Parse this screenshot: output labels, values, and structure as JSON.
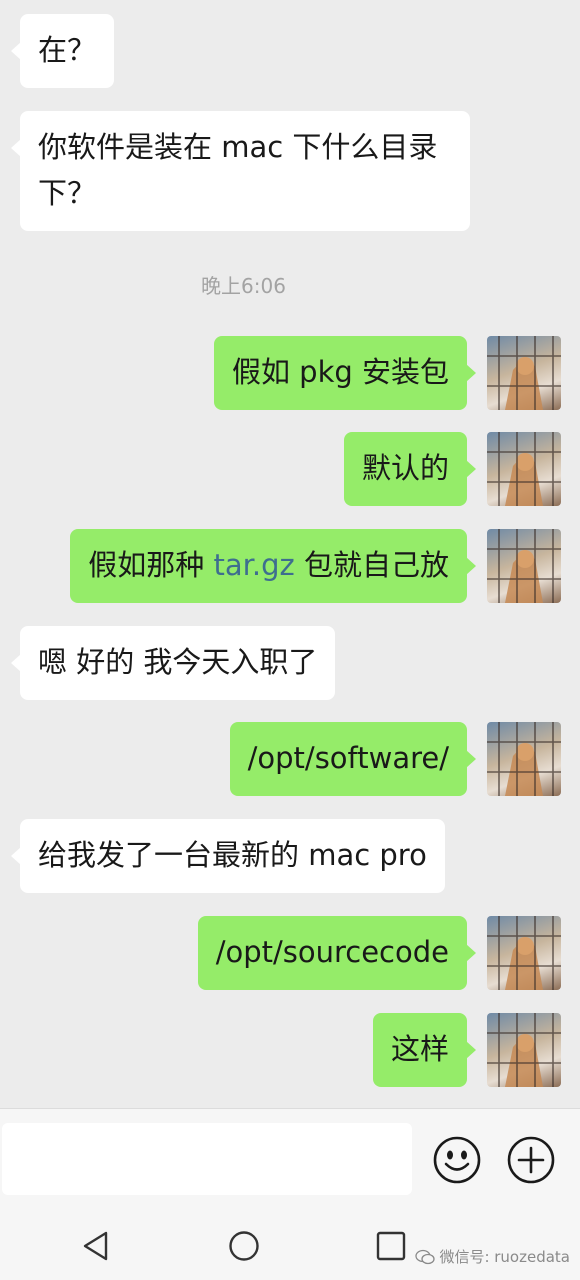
{
  "messages": [
    {
      "side": "in",
      "text": "在？"
    },
    {
      "side": "in",
      "text": "你软件是装在 mac 下什么目录下？"
    },
    {
      "side": "out",
      "text": "假如 pkg 安装包"
    },
    {
      "side": "out",
      "text": "默认的"
    },
    {
      "side": "out",
      "text_before": "假如那种 ",
      "link": "tar.gz",
      "text_after": " 包就自己放"
    },
    {
      "side": "in",
      "text": "嗯 好的 我今天入职了"
    },
    {
      "side": "out",
      "text": "/opt/software/"
    },
    {
      "side": "in",
      "text": "给我发了一台最新的 mac pro"
    },
    {
      "side": "out",
      "text": "/opt/sourcecode"
    },
    {
      "side": "out",
      "text": "这样"
    }
  ],
  "timestamp": "晚上6:06",
  "input": {
    "value": "",
    "emoji_icon": "smiley-face-icon",
    "plus_icon": "plus-circle-icon"
  },
  "nav": {
    "back_icon": "triangle-back-icon",
    "home_icon": "circle-home-icon",
    "recents_icon": "square-recents-icon"
  },
  "watermark": {
    "text": "微信号: ruozedata"
  },
  "colors": {
    "background": "#ececec",
    "outgoing_bubble": "#95ec69",
    "incoming_bubble": "#ffffff",
    "link": "#3e6e8f",
    "timestamp": "#a3a3a3"
  }
}
